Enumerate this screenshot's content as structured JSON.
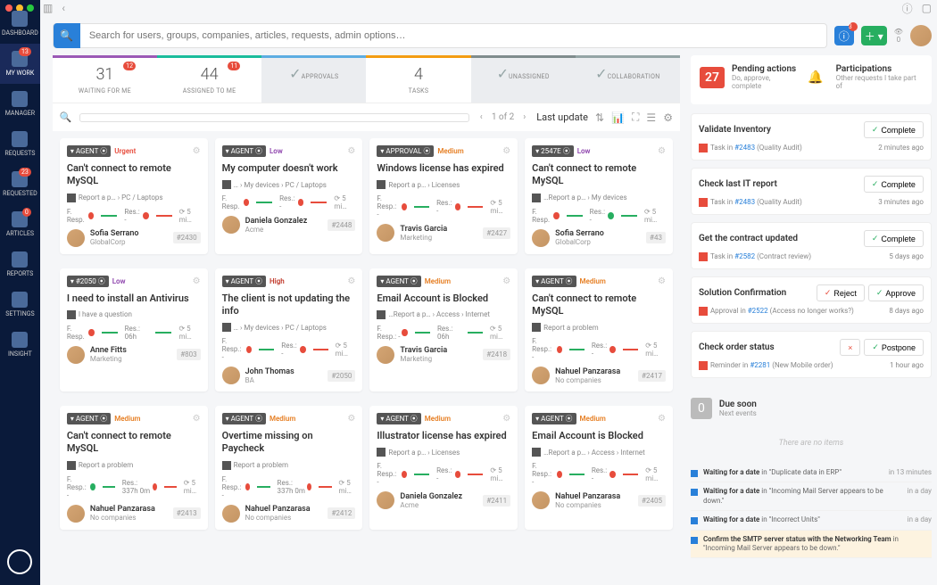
{
  "sidebar": {
    "items": [
      {
        "label": "DASHBOARD",
        "badge": null
      },
      {
        "label": "MY WORK",
        "badge": "13"
      },
      {
        "label": "MANAGER",
        "badge": null
      },
      {
        "label": "REQUESTS",
        "badge": null
      },
      {
        "label": "REQUESTED",
        "badge": "23"
      },
      {
        "label": "ARTICLES",
        "badge": "0"
      },
      {
        "label": "REPORTS",
        "badge": null
      },
      {
        "label": "SETTINGS",
        "badge": null
      },
      {
        "label": "INSIGHT",
        "badge": null
      }
    ]
  },
  "search": {
    "placeholder": "Search for users, groups, companies, articles, requests, admin options…"
  },
  "header": {
    "stat_val": "0"
  },
  "tabs": [
    {
      "count": "31",
      "label": "WAITING FOR ME",
      "badge": "12"
    },
    {
      "count": "44",
      "label": "ASSIGNED TO ME",
      "badge": "11"
    },
    {
      "count": "",
      "label": "APPROVALS",
      "check": true
    },
    {
      "count": "4",
      "label": "TASKS"
    },
    {
      "count": "",
      "label": "UNASSIGNED",
      "check": true
    },
    {
      "count": "",
      "label": "COLLABORATION",
      "check": true
    }
  ],
  "toolbar": {
    "pager": "1 of 2",
    "sort": "Last update"
  },
  "cards": [
    [
      {
        "tag": "AGENT",
        "prio": "Urgent",
        "prioClass": "urgent",
        "title": "Can't connect to remote MySQL",
        "bc": "Report a p… › PC / Laptops",
        "m1": "F. Resp.",
        "d1": "red",
        "m2": "Res.: -",
        "d2": "red",
        "time": "5 mi…",
        "name": "Sofia Serrano",
        "comp": "GlobalCorp",
        "id": "#2430"
      },
      {
        "tag": "AGENT",
        "prio": "Low",
        "prioClass": "low",
        "title": "My computer doesn't work",
        "bc": "… › My devices › PC / Laptops",
        "m1": "F. Resp.",
        "d1": "red",
        "m2": "Res.: -",
        "d2": "red",
        "time": "5 mi…",
        "name": "Daniela Gonzalez",
        "comp": "Acme",
        "id": "#2448"
      },
      {
        "tag": "APPROVAL",
        "prio": "Medium",
        "prioClass": "medium",
        "title": "Windows license has expired",
        "bc": "Report a p… › Licenses",
        "m1": "F. Resp.: -",
        "d1": "red",
        "m2": "Res.: -",
        "d2": "red",
        "time": "5 mi…",
        "name": "Travis Garcia",
        "comp": "Marketing",
        "id": "#2427"
      },
      {
        "tag": "2547E",
        "prio": "Low",
        "prioClass": "low",
        "title": "Can't connect to remote MySQL",
        "bc": "…Report a p… › My devices",
        "m1": "F. Resp.",
        "d1": "red",
        "m2": "Res.: -",
        "d2": "green",
        "time": "5 mi…",
        "name": "Sofia Serrano",
        "comp": "GlobalCorp",
        "id": "#43"
      }
    ],
    [
      {
        "tag": "#2050",
        "prio": "Low",
        "prioClass": "low",
        "title": "I need to install an Antivirus",
        "bc": "I have a question",
        "m1": "F. Resp.",
        "d1": "red",
        "m2": "Res.: 06h",
        "d2": "",
        "time": "5 mi…",
        "name": "Anne Fitts",
        "comp": "Marketing",
        "id": "#803"
      },
      {
        "tag": "AGENT",
        "prio": "High",
        "prioClass": "high",
        "title": "The client is not updating the info",
        "bc": "… › My devices › PC / Laptops",
        "m1": "F. Resp.: -",
        "d1": "red",
        "m2": "Res.: -",
        "d2": "red",
        "time": "5 mi…",
        "name": "John Thomas",
        "comp": "BA",
        "id": "#2050"
      },
      {
        "tag": "AGENT",
        "prio": "Medium",
        "prioClass": "medium",
        "title": "Email Account is Blocked",
        "bc": "…Report a p… › Access › Internet",
        "m1": "F. Resp.: -",
        "d1": "red",
        "m2": "Res.: 06h",
        "d2": "",
        "time": "5 mi…",
        "name": "Travis Garcia",
        "comp": "Marketing",
        "id": "#2418"
      },
      {
        "tag": "AGENT",
        "prio": "Medium",
        "prioClass": "medium",
        "title": "Can't connect to remote MySQL",
        "bc": "Report a problem",
        "m1": "F. Resp.: -",
        "d1": "red",
        "m2": "Res.: -",
        "d2": "red",
        "time": "5 mi…",
        "name": "Nahuel Panzarasa",
        "comp": "No companies",
        "id": "#2417"
      }
    ],
    [
      {
        "tag": "AGENT",
        "prio": "Medium",
        "prioClass": "medium",
        "title": "Can't connect to remote MySQL",
        "bc": "Report a problem",
        "m1": "F. Resp.: -",
        "d1": "green",
        "m2": "Res.: 337h 0m",
        "d2": "red",
        "time": "5 mi…",
        "name": "Nahuel Panzarasa",
        "comp": "No companies",
        "id": "#2413"
      },
      {
        "tag": "AGENT",
        "prio": "Medium",
        "prioClass": "medium",
        "title": "Overtime missing on Paycheck",
        "bc": "Report a problem",
        "m1": "F. Resp.: -",
        "d1": "red",
        "m2": "Res.: 337h 0m",
        "d2": "red",
        "time": "5 mi…",
        "name": "Nahuel Panzarasa",
        "comp": "No companies",
        "id": "#2412"
      },
      {
        "tag": "AGENT",
        "prio": "Medium",
        "prioClass": "medium",
        "title": "Illustrator license has expired",
        "bc": "Report a p… › Licenses",
        "m1": "F. Resp.: -",
        "d1": "red",
        "m2": "Res.: -",
        "d2": "red",
        "time": "5 mi…",
        "name": "Daniela Gonzalez",
        "comp": "Acme",
        "id": "#2411"
      },
      {
        "tag": "AGENT",
        "prio": "Medium",
        "prioClass": "medium",
        "title": "Email Account is Blocked",
        "bc": "…Report a p… › Access › Internet",
        "m1": "F. Resp.: -",
        "d1": "red",
        "m2": "Res.: -",
        "d2": "red",
        "time": "5 mi…",
        "name": "Nahuel Panzarasa",
        "comp": "No companies",
        "id": "#2405"
      }
    ]
  ],
  "pending": {
    "count": "27",
    "title": "Pending actions",
    "subtitle": "Do, approve, complete",
    "part_title": "Participations",
    "part_sub": "Other requests I take part of"
  },
  "actions": [
    {
      "title": "Validate Inventory",
      "btns": [
        {
          "label": "Complete",
          "cls": ""
        }
      ],
      "type": "Task",
      "ref": "#2483",
      "extra": "(Quality Audit)",
      "time": "2 minutes ago"
    },
    {
      "title": "Check last IT report",
      "btns": [
        {
          "label": "Complete",
          "cls": ""
        }
      ],
      "type": "Task",
      "ref": "#2483",
      "extra": "(Quality Audit)",
      "time": "3 minutes ago"
    },
    {
      "title": "Get the contract updated",
      "btns": [
        {
          "label": "Complete",
          "cls": ""
        }
      ],
      "type": "Task",
      "ref": "#2582",
      "extra": "(Contract review)",
      "time": "5 days ago"
    },
    {
      "title": "Solution Confirmation",
      "btns": [
        {
          "label": "Reject",
          "cls": "reject"
        },
        {
          "label": "Approve",
          "cls": ""
        }
      ],
      "type": "Approval",
      "ref": "#2522",
      "extra": "(Access no longer works?)",
      "time": "8 days ago"
    },
    {
      "title": "Check order status",
      "btns": [
        {
          "label": "",
          "cls": "reject",
          "icon": "×"
        },
        {
          "label": "Postpone",
          "cls": ""
        }
      ],
      "type": "Reminder",
      "ref": "#2281",
      "extra": "(New Mobile order)",
      "time": "1 hour ago"
    }
  ],
  "dueSoon": {
    "count": "0",
    "title": "Due soon",
    "subtitle": "Next events",
    "empty": "There are no items"
  },
  "events": [
    {
      "bold": "Waiting for a date",
      "text": " in \"Duplicate data in ERP\"",
      "time": "in 13 minutes"
    },
    {
      "bold": "Waiting for a date",
      "text": " in \"Incoming Mail Server appears to be down.\"",
      "time": "in a day"
    },
    {
      "bold": "Waiting for a date",
      "text": " in \"Incorrect Units\"",
      "time": "in a day"
    },
    {
      "bold": "Confirm the SMTP server status with the Networking Team",
      "text": " in \"Incoming Mail Server appears to be down.\"",
      "time": "",
      "highlight": true
    }
  ]
}
